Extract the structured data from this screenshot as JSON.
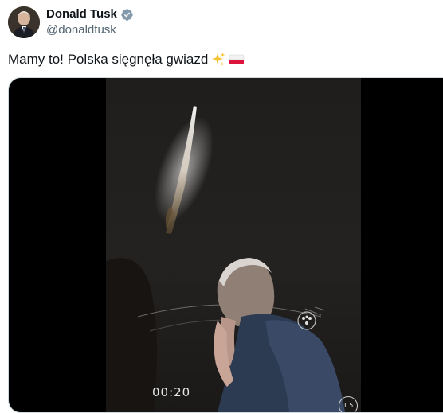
{
  "author": {
    "name": "Donald Tusk",
    "handle": "@donaldtusk",
    "verified": true,
    "avatar": "avatar"
  },
  "tweet": {
    "text": "Mamy to! Polska sięgnęła gwiazd",
    "emojis": [
      "sparkles-emoji",
      "poland-flag-emoji"
    ]
  },
  "media": {
    "type": "video",
    "overlay": {
      "time": "00:20",
      "speed": "1.5"
    }
  },
  "colors": {
    "text": "#0f1419",
    "secondary": "#536471",
    "verified": "#829aab",
    "border": "#cfd9de"
  }
}
